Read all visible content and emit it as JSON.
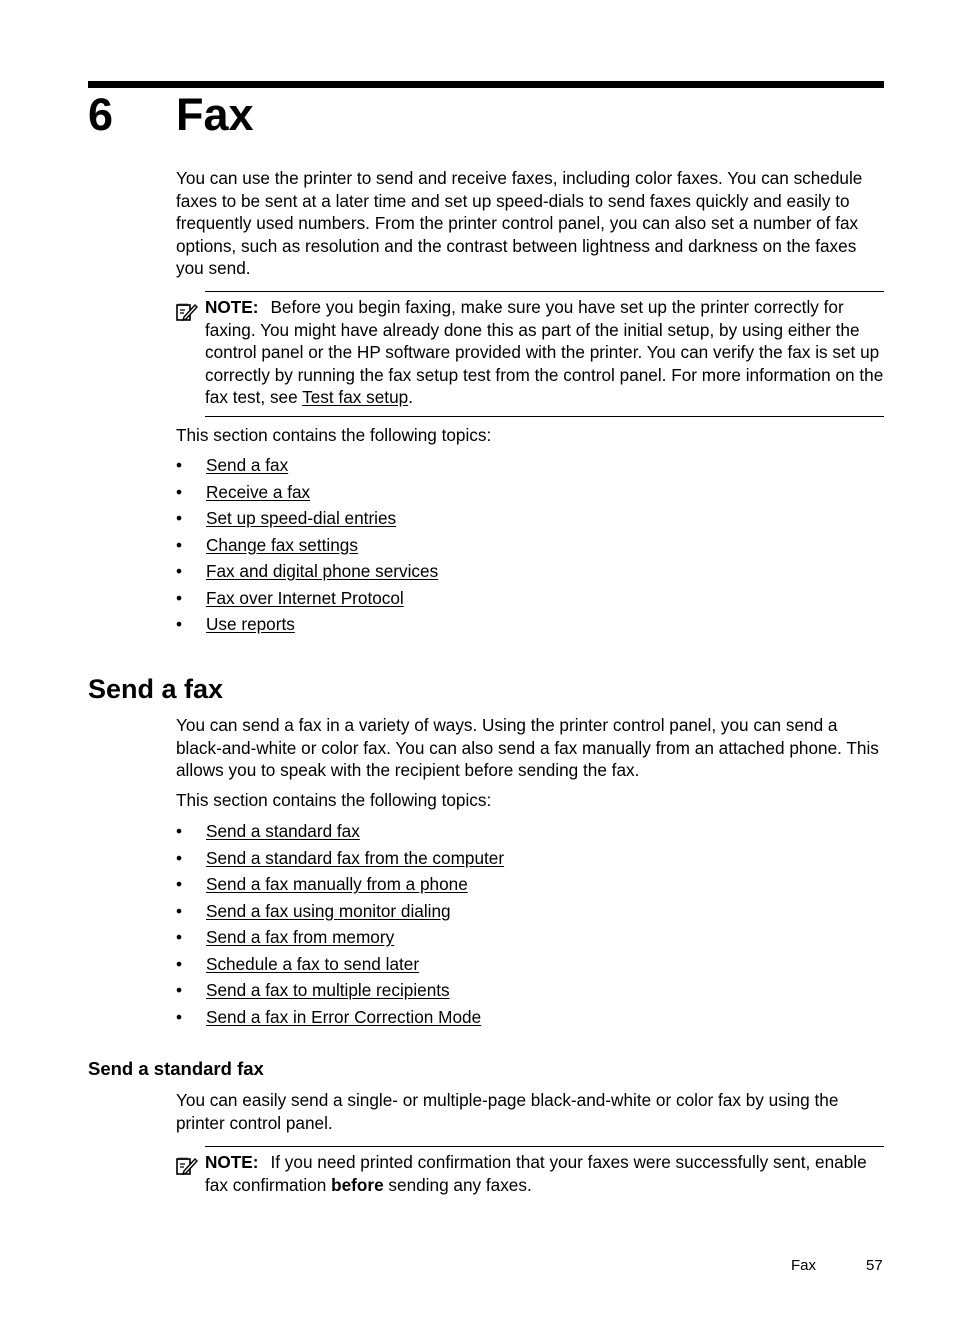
{
  "chapter": {
    "number": "6",
    "title": "Fax"
  },
  "intro": {
    "paragraph": "You can use the printer to send and receive faxes, including color faxes. You can schedule faxes to be sent at a later time and set up speed-dials to send faxes quickly and easily to frequently used numbers. From the printer control panel, you can also set a number of fax options, such as resolution and the contrast between lightness and darkness on the faxes you send.",
    "note": {
      "icon": "note-pencil-icon",
      "label": "NOTE:",
      "text": "Before you begin faxing, make sure you have set up the printer correctly for faxing. You might have already done this as part of the initial setup, by using either the control panel or the HP software provided with the printer. You can verify the fax is set up correctly by running the fax setup test from the control panel. For more information on the fax test, see ",
      "link": "Test fax setup",
      "suffix": "."
    },
    "topics_intro": "This section contains the following topics:",
    "topics": [
      "Send a fax",
      "Receive a fax",
      "Set up speed-dial entries",
      "Change fax settings",
      "Fax and digital phone services",
      "Fax over Internet Protocol",
      "Use reports"
    ]
  },
  "send_a_fax": {
    "heading": "Send a fax",
    "paragraph": "You can send a fax in a variety of ways. Using the printer control panel, you can send a black-and-white or color fax. You can also send a fax manually from an attached phone. This allows you to speak with the recipient before sending the fax.",
    "topics_intro": "This section contains the following topics:",
    "topics": [
      "Send a standard fax",
      "Send a standard fax from the computer",
      "Send a fax manually from a phone",
      "Send a fax using monitor dialing",
      "Send a fax from memory",
      "Schedule a fax to send later",
      "Send a fax to multiple recipients",
      "Send a fax in Error Correction Mode"
    ]
  },
  "send_standard_fax": {
    "heading": "Send a standard fax",
    "paragraph": "You can easily send a single- or multiple-page black-and-white or color fax by using the printer control panel.",
    "note": {
      "icon": "note-pencil-icon",
      "label": "NOTE:",
      "text_before": "If you need printed confirmation that your faxes were successfully sent, enable fax confirmation ",
      "bold": "before",
      "text_after": " sending any faxes."
    }
  },
  "footer": {
    "section": "Fax",
    "page_number": "57"
  }
}
